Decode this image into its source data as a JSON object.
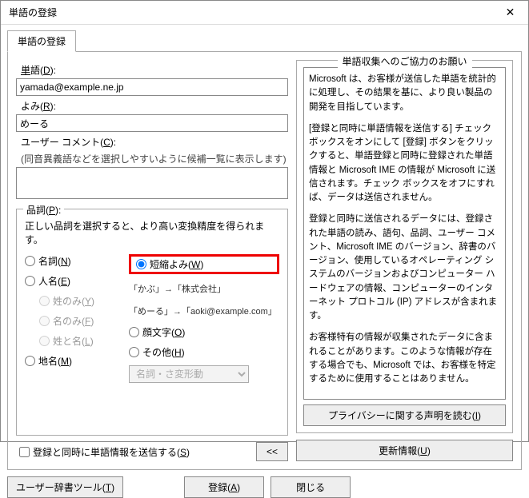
{
  "window": {
    "title": "単語の登録"
  },
  "tab": {
    "label": "単語の登録"
  },
  "fields": {
    "tango_label": "単語(D):",
    "tango_value": "yamada@example.ne.jp",
    "yomi_label": "よみ(R):",
    "yomi_value": "めーる",
    "comment_label": "ユーザー コメント(C):",
    "comment_sub": "(同音異義語などを選択しやすいように候補一覧に表示します)",
    "comment_value": ""
  },
  "hinshi": {
    "title": "品詞(P):",
    "desc": "正しい品詞を選択すると、より高い変換精度を得られます。",
    "meishi": "名詞(N)",
    "jinmei": "人名(E)",
    "sei": "姓のみ(Y)",
    "mei": "名のみ(F)",
    "seimei": "姓と名(L)",
    "chimei": "地名(M)",
    "tanshuku": "短縮よみ(W)",
    "ex1": "「かぶ」→「株式会社」",
    "ex2": "「めーる」→「aoki@example.com」",
    "kaomoji": "顔文字(O)",
    "sonota": "その他(H)",
    "select_value": "名詞・さ変形動"
  },
  "right": {
    "title": "単語収集へのご協力のお願い",
    "p1": "Microsoft は、お客様が送信した単語を統計的に処理し、その結果を基に、より良い製品の開発を目指しています。",
    "p2": "[登録と同時に単語情報を送信する] チェック ボックスをオンにして [登録] ボタンをクリックすると、単語登録と同時に登録された単語情報と Microsoft IME の情報が Microsoft に送信されます。チェック ボックスをオフにすれば、データは送信されません。",
    "p3": "登録と同時に送信されるデータには、登録された単語の読み、語句、品詞、ユーザー コメント、Microsoft IME のバージョン、辞書のバージョン、使用しているオペレーティング システムのバージョンおよびコンピューター ハードウェアの情報、コンピューターのインターネット プロトコル (IP) アドレスが含まれます。",
    "p4": "お客様特有の情報が収集されたデータに含まれることがあります。このような情報が存在する場合でも、Microsoft では、お客様を特定するために使用することはありません。",
    "privacy_btn": "プライバシーに関する声明を読む(I)"
  },
  "bottom": {
    "send_checkbox": "登録と同時に単語情報を送信する(S)",
    "toggle": "<<",
    "update_btn": "更新情報(U)",
    "dict_tool": "ユーザー辞書ツール(T)",
    "register": "登録(A)",
    "close": "閉じる"
  }
}
